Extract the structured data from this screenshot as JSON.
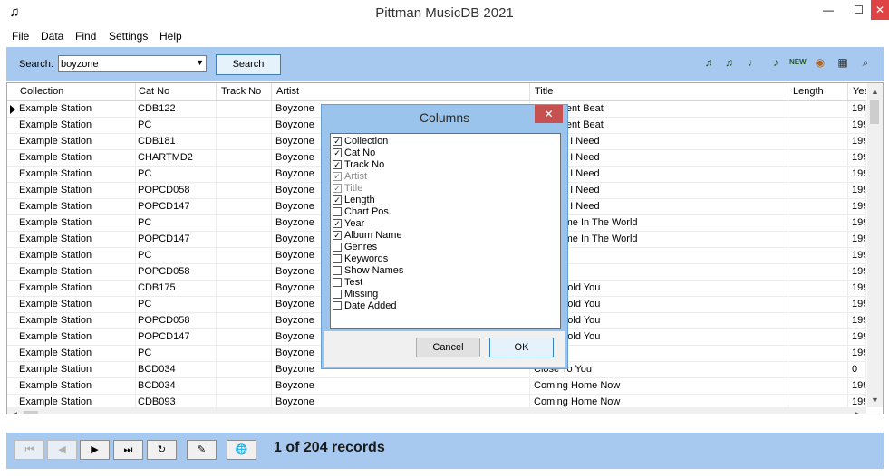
{
  "window": {
    "title": "Pittman MusicDB 2021",
    "app_icon": "music-note-icon",
    "min_glyph": "—",
    "max_glyph": "☐",
    "close_glyph": "✕"
  },
  "menu": [
    "File",
    "Data",
    "Find",
    "Settings",
    "Help"
  ],
  "search": {
    "label": "Search:",
    "value": "boyzone",
    "button": "Search"
  },
  "toolbar_icons": [
    "music-note-add-icon",
    "music-notes-icon",
    "music-tools-icon",
    "music-list-icon",
    "new-icon",
    "disc-icon",
    "grid-icon",
    "music-search-icon"
  ],
  "grid": {
    "columns": [
      "Collection",
      "Cat No",
      "Track No",
      "Artist",
      "Title",
      "Length",
      "Yea"
    ],
    "rows": [
      [
        "Example Station",
        "CDB122",
        "",
        "Boyzone",
        "A Different Beat",
        "",
        "199"
      ],
      [
        "Example Station",
        "PC",
        "",
        "Boyzone",
        "A Different Beat",
        "",
        "199"
      ],
      [
        "Example Station",
        "CDB181",
        "",
        "Boyzone",
        "All That I Need",
        "",
        "199"
      ],
      [
        "Example Station",
        "CHARTMD2",
        "",
        "Boyzone",
        "All That I Need",
        "",
        "199"
      ],
      [
        "Example Station",
        "PC",
        "",
        "Boyzone",
        "All That I Need",
        "",
        "199"
      ],
      [
        "Example Station",
        "POPCD058",
        "",
        "Boyzone",
        "All That I Need",
        "",
        "199"
      ],
      [
        "Example Station",
        "POPCD147",
        "",
        "Boyzone",
        "All That I Need",
        "",
        "199"
      ],
      [
        "Example Station",
        "PC",
        "",
        "Boyzone",
        "Best Time In The World",
        "",
        "199"
      ],
      [
        "Example Station",
        "POPCD147",
        "",
        "Boyzone",
        "Best Time In The World",
        "",
        "199"
      ],
      [
        "Example Station",
        "PC",
        "",
        "Boyzone",
        "",
        "",
        "199"
      ],
      [
        "Example Station",
        "POPCD058",
        "",
        "Boyzone",
        "",
        "",
        "199"
      ],
      [
        "Example Station",
        "CDB175",
        "",
        "Boyzone",
        "Can I Hold You",
        "",
        "199"
      ],
      [
        "Example Station",
        "PC",
        "",
        "Boyzone",
        "Can I Hold You",
        "",
        "199"
      ],
      [
        "Example Station",
        "POPCD058",
        "",
        "Boyzone",
        "Can I Hold You",
        "",
        "199"
      ],
      [
        "Example Station",
        "POPCD147",
        "",
        "Boyzone",
        "Can I Hold You",
        "",
        "199"
      ],
      [
        "Example Station",
        "PC",
        "",
        "Boyzone",
        "",
        "",
        "199"
      ],
      [
        "Example Station",
        "BCD034",
        "",
        "Boyzone",
        "Close To You",
        "",
        "0"
      ],
      [
        "Example Station",
        "BCD034",
        "",
        "Boyzone",
        "Coming Home Now",
        "",
        "199"
      ],
      [
        "Example Station",
        "CDB093",
        "",
        "Boyzone",
        "Coming Home Now",
        "",
        "199"
      ]
    ]
  },
  "dialog": {
    "title": "Columns",
    "close_glyph": "✕",
    "items": [
      {
        "label": "Collection",
        "checked": true,
        "enabled": true
      },
      {
        "label": "Cat No",
        "checked": true,
        "enabled": true
      },
      {
        "label": "Track No",
        "checked": true,
        "enabled": true
      },
      {
        "label": "Artist",
        "checked": true,
        "enabled": false
      },
      {
        "label": "Title",
        "checked": true,
        "enabled": false
      },
      {
        "label": "Length",
        "checked": true,
        "enabled": true
      },
      {
        "label": "Chart Pos.",
        "checked": false,
        "enabled": true
      },
      {
        "label": "Year",
        "checked": true,
        "enabled": true
      },
      {
        "label": "Album Name",
        "checked": true,
        "enabled": true
      },
      {
        "label": "Genres",
        "checked": false,
        "enabled": true
      },
      {
        "label": "Keywords",
        "checked": false,
        "enabled": true
      },
      {
        "label": "Show Names",
        "checked": false,
        "enabled": true
      },
      {
        "label": "Test",
        "checked": false,
        "enabled": true
      },
      {
        "label": "Missing",
        "checked": false,
        "enabled": true
      },
      {
        "label": "Date Added",
        "checked": false,
        "enabled": true
      }
    ],
    "cancel": "Cancel",
    "ok": "OK"
  },
  "nav": {
    "buttons": [
      {
        "name": "first-record-button",
        "glyph": "⏮",
        "enabled": false
      },
      {
        "name": "previous-record-button",
        "glyph": "◀",
        "enabled": false
      },
      {
        "name": "next-record-button",
        "glyph": "▶",
        "enabled": true
      },
      {
        "name": "last-record-button",
        "glyph": "⏭",
        "enabled": true
      },
      {
        "name": "refresh-button",
        "glyph": "↻",
        "enabled": true
      },
      {
        "name": "edit-pen-button",
        "glyph": "✎",
        "enabled": true
      },
      {
        "name": "globe-button",
        "glyph": "🌐",
        "enabled": true
      }
    ],
    "record_count": "1 of 204 records"
  }
}
